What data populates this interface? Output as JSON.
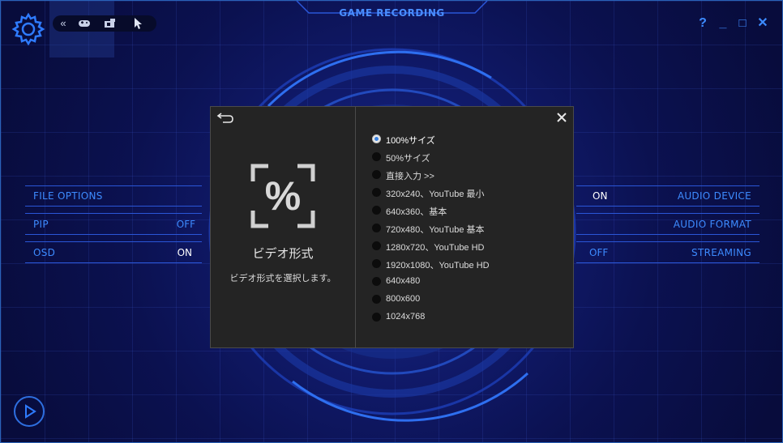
{
  "app": {
    "title": "GAME RECORDING",
    "help_label": "?",
    "minimize_label": "_",
    "maximize_label": "□",
    "close_label": "✕"
  },
  "toolbar": {
    "items": [
      {
        "name": "collapse-icon",
        "glyph": "«"
      },
      {
        "name": "gamepad-icon",
        "glyph": "🎮"
      },
      {
        "name": "camera-icon",
        "glyph": "▣"
      },
      {
        "name": "cursor-icon",
        "glyph": "➤"
      }
    ]
  },
  "left_options": [
    {
      "label": "FILE OPTIONS",
      "value": ""
    },
    {
      "label": "PIP",
      "value": "OFF"
    },
    {
      "label": "OSD",
      "value": "ON"
    }
  ],
  "right_options": [
    {
      "label": "AUDIO DEVICE",
      "value": "ON"
    },
    {
      "label": "AUDIO FORMAT",
      "value": ""
    },
    {
      "label": "STREAMING",
      "value": "OFF"
    }
  ],
  "dialog": {
    "icon_glyph": "%",
    "title": "ビデオ形式",
    "description": "ビデオ形式を選択します。",
    "selected_index": 0,
    "options": [
      "100%サイズ",
      "50%サイズ",
      "直接入力 >>",
      "320x240、YouTube 最小",
      "640x360、基本",
      "720x480、YouTube 基本",
      "1280x720、YouTube HD",
      "1920x1080、YouTube HD",
      "640x480",
      "800x600",
      "1024x768"
    ]
  },
  "colors": {
    "accent": "#3d8bff",
    "value_on": "#ffffff",
    "value_off": "#3d8bff",
    "dialog_bg": "#242424"
  }
}
